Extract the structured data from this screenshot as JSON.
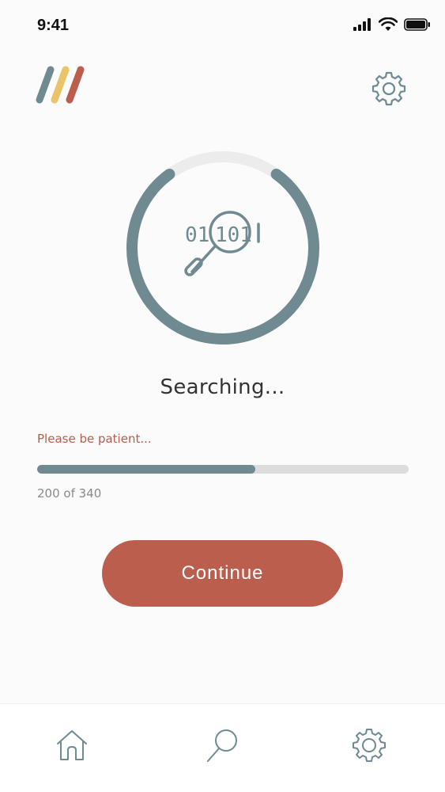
{
  "status_bar": {
    "time": "9:41",
    "icons": [
      "signal-icon",
      "wifi-icon",
      "battery-icon"
    ]
  },
  "header": {
    "logo_icon": "stripes-logo",
    "settings_icon": "gear-icon"
  },
  "search": {
    "ring_progress": 0.8,
    "center_icon": "binary-search-icon",
    "binary_text_left": "01",
    "binary_text_mid": "101",
    "title": "Searching...",
    "subtitle": "Please be patient...",
    "progress": {
      "current": 200,
      "total": 340
    },
    "count_label": "200 of 340"
  },
  "actions": {
    "continue_label": "Continue"
  },
  "tab_bar": {
    "items": [
      {
        "name": "home",
        "icon": "home-icon"
      },
      {
        "name": "search",
        "icon": "search-icon"
      },
      {
        "name": "settings",
        "icon": "gear-icon"
      }
    ]
  },
  "colors": {
    "accent": "#bc5e4d",
    "ring": "#6f8a91",
    "track": "#e8e8e8",
    "logo_stripes": [
      "#6f8a91",
      "#e9c46a",
      "#bc5e4d"
    ],
    "subtitle_text": "#b45e4c"
  }
}
